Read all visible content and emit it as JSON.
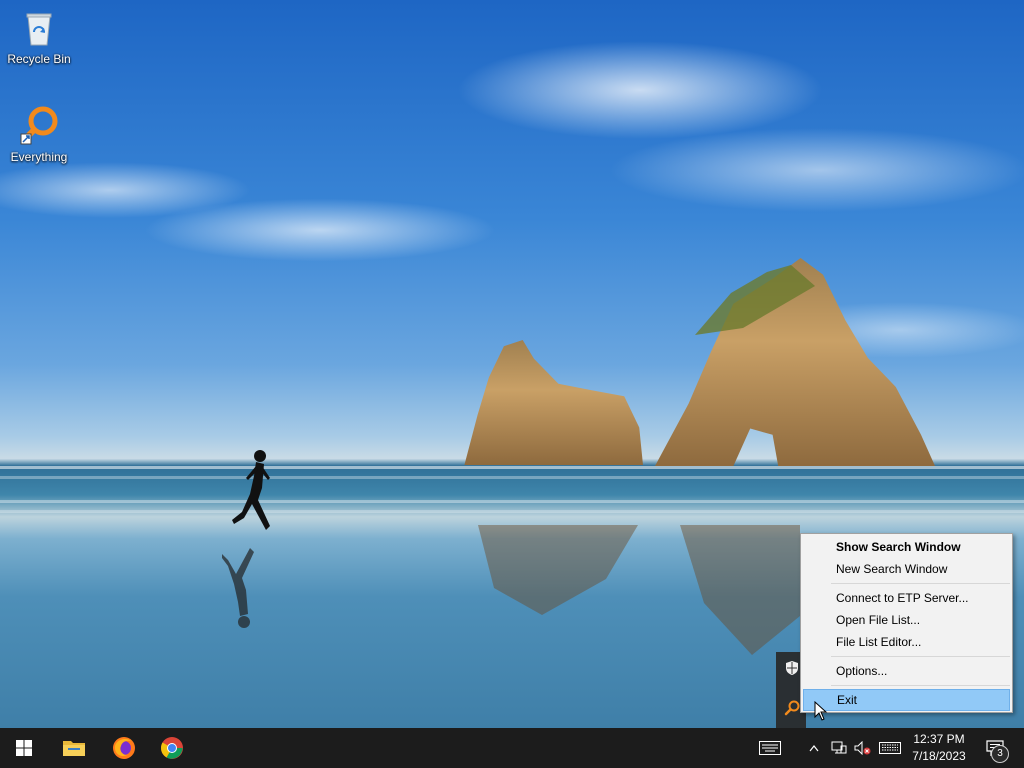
{
  "desktop": {
    "icons": [
      {
        "label": "Recycle Bin",
        "icon": "recycle-bin-icon"
      },
      {
        "label": "Everything",
        "icon": "everything-search-icon"
      }
    ]
  },
  "context_menu": {
    "items": [
      {
        "label": "Show Search Window",
        "bold": true
      },
      {
        "label": "New Search Window"
      },
      {
        "separator": true
      },
      {
        "label": "Connect to ETP Server..."
      },
      {
        "label": "Open File List..."
      },
      {
        "label": "File List Editor..."
      },
      {
        "separator": true
      },
      {
        "label": "Options..."
      },
      {
        "separator": true
      },
      {
        "label": "Exit",
        "highlighted": true
      }
    ]
  },
  "taskbar": {
    "pinned": [
      {
        "name": "start-button",
        "icon": "windows-logo-icon"
      },
      {
        "name": "file-explorer-button",
        "icon": "folder-icon"
      },
      {
        "name": "firefox-button",
        "icon": "firefox-icon"
      },
      {
        "name": "chrome-button",
        "icon": "chrome-icon"
      }
    ],
    "tray": {
      "icons": [
        "touch-keyboard-icon",
        "show-hidden-icons-chevron",
        "network-icon",
        "volume-muted-icon",
        "keyboard-icon"
      ],
      "time": "12:37 PM",
      "date": "7/18/2023",
      "notification_count": "3"
    }
  },
  "colors": {
    "taskbar": "#1c1c1c",
    "menu_background": "#f2f2f2",
    "menu_highlight": "#91c9f7",
    "everything_orange": "#f28a1c"
  }
}
